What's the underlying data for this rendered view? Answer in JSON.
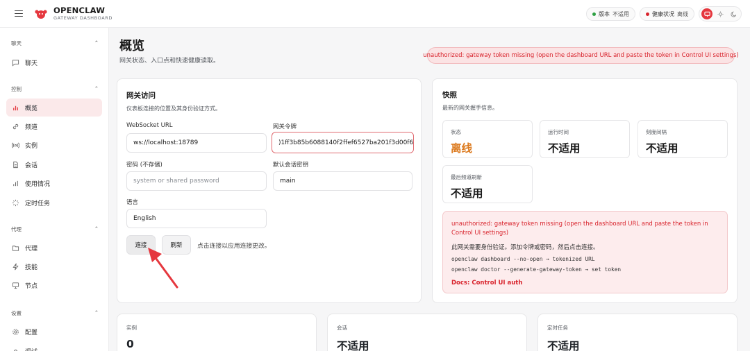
{
  "app": {
    "title": "OPENCLAW",
    "subtitle": "GATEWAY DASHBOARD"
  },
  "status": {
    "version_label": "版本",
    "version_value": "不适用",
    "health_label": "健康状况",
    "health_value": "离线",
    "version_dot_color": "#2ea043",
    "health_dot_color": "#d8232c"
  },
  "sidebar": {
    "sections": [
      {
        "label": "聊天",
        "items": [
          {
            "label": "聊天",
            "icon": "chat-icon"
          }
        ]
      },
      {
        "label": "控制",
        "items": [
          {
            "label": "概览",
            "icon": "bar-chart-icon",
            "active": true
          },
          {
            "label": "频道",
            "icon": "link-icon"
          },
          {
            "label": "实例",
            "icon": "radio-icon"
          },
          {
            "label": "会话",
            "icon": "document-icon"
          },
          {
            "label": "使用情况",
            "icon": "stats-icon"
          },
          {
            "label": "定时任务",
            "icon": "loader-icon"
          }
        ]
      },
      {
        "label": "代理",
        "items": [
          {
            "label": "代理",
            "icon": "folder-icon"
          },
          {
            "label": "技能",
            "icon": "lightning-icon"
          },
          {
            "label": "节点",
            "icon": "monitor-icon"
          }
        ]
      },
      {
        "label": "设置",
        "items": [
          {
            "label": "配置",
            "icon": "gear-icon"
          },
          {
            "label": "调试",
            "icon": "bug-icon"
          }
        ]
      }
    ]
  },
  "header": {
    "title": "概览",
    "subtitle": "网关状态、入口点和快速健康读取。",
    "error": "unauthorized: gateway token missing (open the dashboard URL and paste the token in Control UI settings)"
  },
  "gateway": {
    "title": "网关访问",
    "subtitle": "仪表板连接的位置及其身份验证方式。",
    "ws_label": "WebSocket URL",
    "ws_value": "ws://localhost:18789",
    "token_label": "网关令牌",
    "token_value": ")1ff3b85b6088140f2ffef6527ba201f3d00f6",
    "password_label": "密码 (不存储)",
    "password_placeholder": "system or shared password",
    "session_label": "默认会话密钥",
    "session_value": "main",
    "language_label": "语言",
    "language_value": "English",
    "connect_label": "连接",
    "refresh_label": "刷新",
    "hint": "点击连接以应用连接更改。"
  },
  "snapshot": {
    "title": "快照",
    "subtitle": "最新的网关握手信息。",
    "stats": [
      {
        "label": "状态",
        "value": "离线"
      },
      {
        "label": "运行时间",
        "value": "不适用"
      },
      {
        "label": "刻度间隔",
        "value": "不适用"
      },
      {
        "label": "最后频道刷新",
        "value": "不适用"
      }
    ],
    "alert": {
      "message": "unauthorized: gateway token missing (open the dashboard URL and paste the token in Control UI settings)",
      "hint": "此网关需要身份验证。添加令牌或密码，然后点击连接。",
      "cmd1": "openclaw dashboard --no-open → tokenized URL",
      "cmd2": "openclaw doctor --generate-gateway-token → set token",
      "docs": "Docs: Control UI auth"
    }
  },
  "bottom": [
    {
      "label": "实例",
      "value": "0"
    },
    {
      "label": "会话",
      "value": "不适用"
    },
    {
      "label": "定时任务",
      "value": "不适用"
    }
  ],
  "colors": {
    "accent": "#e5373e",
    "error": "#d8232c",
    "warning": "#dc7a1e"
  }
}
